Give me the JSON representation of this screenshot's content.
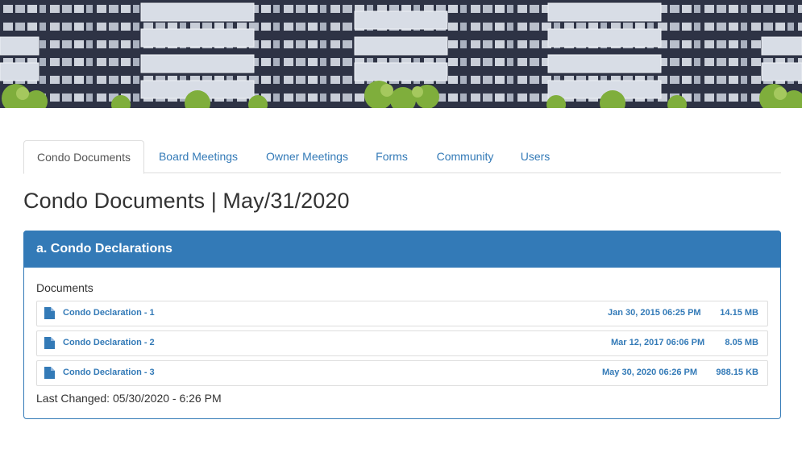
{
  "tabs": [
    {
      "label": "Condo Documents",
      "active": true
    },
    {
      "label": "Board Meetings",
      "active": false
    },
    {
      "label": "Owner Meetings",
      "active": false
    },
    {
      "label": "Forms",
      "active": false
    },
    {
      "label": "Community",
      "active": false
    },
    {
      "label": "Users",
      "active": false
    }
  ],
  "page": {
    "title": "Condo Documents | May/31/2020"
  },
  "panel": {
    "heading": "a. Condo Declarations",
    "documents_label": "Documents",
    "documents": [
      {
        "name": "Condo Declaration - 1",
        "date": "Jan 30, 2015 06:25 PM",
        "size": "14.15 MB",
        "icon": "file-icon"
      },
      {
        "name": "Condo Declaration - 2",
        "date": "Mar 12, 2017 06:06 PM",
        "size": "8.05 MB",
        "icon": "file-icon"
      },
      {
        "name": "Condo Declaration - 3",
        "date": "May 30, 2020 06:26 PM",
        "size": "988.15 KB",
        "icon": "file-icon"
      }
    ],
    "last_changed": "Last Changed: 05/30/2020 - 6:26 PM"
  },
  "colors": {
    "primary": "#337ab7",
    "text": "#333333",
    "border": "#dddddd",
    "banner_facade": "#2f3446"
  }
}
